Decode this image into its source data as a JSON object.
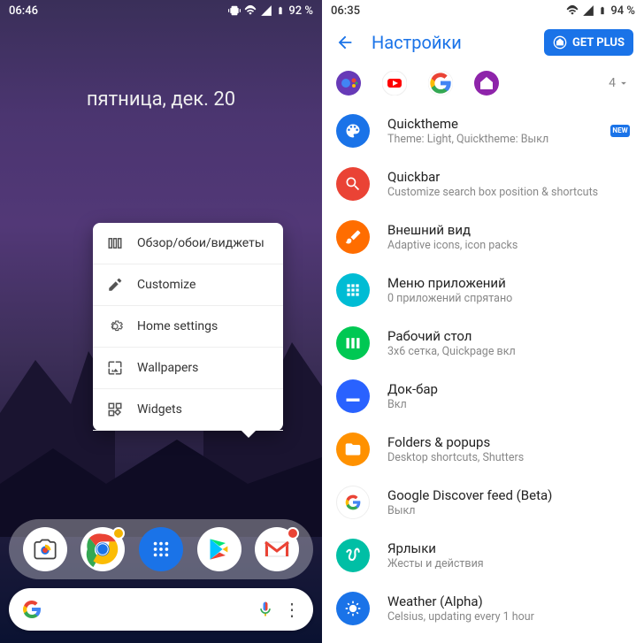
{
  "left": {
    "status": {
      "time": "06:46",
      "battery": "92 %"
    },
    "date_widget": "пятница, дек. 20",
    "context_menu": [
      {
        "label": "Обзор/обои/виджеты"
      },
      {
        "label": "Customize"
      },
      {
        "label": "Home settings"
      },
      {
        "label": "Wallpapers"
      },
      {
        "label": "Widgets"
      }
    ],
    "search_placeholder": ""
  },
  "right": {
    "status": {
      "time": "06:35",
      "battery": "94 %"
    },
    "appbar": {
      "title": "Настройки",
      "getplus": "GET PLUS"
    },
    "quickrow_count": "4",
    "settings": [
      {
        "icon_color": "#1a73e8",
        "title": "Quicktheme",
        "sub": "Theme: Light, Quicktheme: Выкл",
        "new": "NEW"
      },
      {
        "icon_color": "#ea4335",
        "title": "Quickbar",
        "sub": "Customize search box position & shortcuts"
      },
      {
        "icon_color": "#ff6d00",
        "title": "Внешний вид",
        "sub": "Adaptive icons, icon packs"
      },
      {
        "icon_color": "#00bcd4",
        "title": "Меню приложений",
        "sub": "0 приложений спрятано"
      },
      {
        "icon_color": "#00c853",
        "title": "Рабочий стол",
        "sub": "3x6 сетка, Quickpage вкл"
      },
      {
        "icon_color": "#2962ff",
        "title": "Док-бар",
        "sub": "Вкл"
      },
      {
        "icon_color": "#ff9100",
        "title": "Folders & popups",
        "sub": "Desktop shortcuts, Shutters"
      },
      {
        "icon_color": "#ffffff",
        "title": "Google Discover feed (Beta)",
        "sub": "Выкл",
        "google": true
      },
      {
        "icon_color": "#00bfa5",
        "title": "Ярлыки",
        "sub": "Жесты и действия"
      },
      {
        "icon_color": "#1a73e8",
        "title": "Weather (Alpha)",
        "sub": "Celsius, updating every 1 hour"
      }
    ]
  }
}
